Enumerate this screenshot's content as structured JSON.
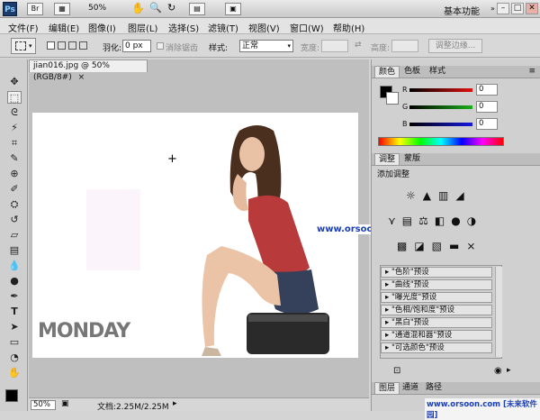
{
  "app": {
    "logo": "Ps",
    "zoom": "50%",
    "workspace": "基本功能",
    "min_btn": "–",
    "max_btn": "□",
    "close_btn": "✕"
  },
  "menu": [
    "文件(F)",
    "编辑(E)",
    "图像(I)",
    "图层(L)",
    "选择(S)",
    "滤镜(T)",
    "视图(V)",
    "窗口(W)",
    "帮助(H)"
  ],
  "options": {
    "feather_label": "羽化:",
    "feather_value": "0 px",
    "antialias_label": "消除锯齿",
    "style_label": "样式:",
    "style_value": "正常",
    "width_label": "宽度:",
    "height_label": "高度:",
    "refine_edge": "调整边缘..."
  },
  "document": {
    "tab_title": "jian016.jpg @ 50%(RGB/8#)",
    "zoom_status": "50%",
    "doc_info": "文档:2.25M/2.25M"
  },
  "image_content": {
    "watermark_url": "www.orsoon.com",
    "logo_text": "MONDAY"
  },
  "color_panel": {
    "tabs": [
      "颜色",
      "色板",
      "样式"
    ],
    "channels": [
      {
        "label": "R",
        "value": "0",
        "color": "#d42020"
      },
      {
        "label": "G",
        "value": "0",
        "color": "#1faa1f"
      },
      {
        "label": "B",
        "value": "0",
        "color": "#2020d0"
      }
    ]
  },
  "adjust_panel": {
    "tabs": [
      "调整",
      "蒙版"
    ],
    "title": "添加调整",
    "presets": [
      "\"色阶\"预设",
      "\"曲线\"预设",
      "\"曝光度\"预设",
      "\"色相/饱和度\"预设",
      "\"黑白\"预设",
      "\"通道混和器\"预设",
      "\"可选颜色\"预设"
    ]
  },
  "layers_panel": {
    "tabs": [
      "图层",
      "通道",
      "路径"
    ]
  },
  "footer_watermark": "www.orsoon.com [未来软件园]",
  "colors": {
    "foreground": "#000000",
    "background": "#ffffff",
    "watermark_blue": "#1a3fb8"
  }
}
